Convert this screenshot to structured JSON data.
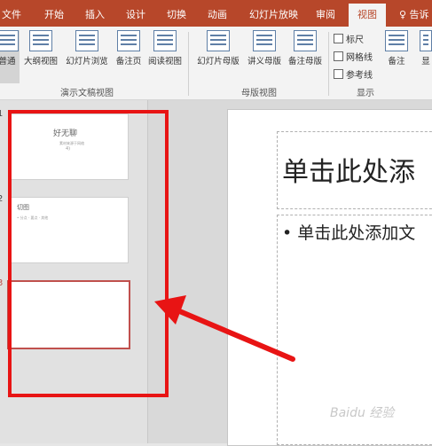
{
  "tabs": [
    {
      "label": "文件",
      "active": false
    },
    {
      "label": "开始",
      "active": false
    },
    {
      "label": "插入",
      "active": false
    },
    {
      "label": "设计",
      "active": false
    },
    {
      "label": "切换",
      "active": false
    },
    {
      "label": "动画",
      "active": false
    },
    {
      "label": "幻灯片放映",
      "active": false
    },
    {
      "label": "审阅",
      "active": false
    },
    {
      "label": "视图",
      "active": true
    }
  ],
  "tell_me": "♀ 告诉",
  "ribbon": {
    "presentation_views": {
      "label": "演示文稿视图",
      "buttons": [
        "普通",
        "大纲视图",
        "幻灯片浏览",
        "备注页",
        "阅读视图"
      ]
    },
    "master_views": {
      "label": "母版视图",
      "buttons": [
        "幻灯片母版",
        "讲义母版",
        "备注母版"
      ]
    },
    "show": {
      "label": "显示",
      "checkboxes": [
        "标尺",
        "网格线",
        "参考线"
      ],
      "notes_button": "备注",
      "cut_button": "显"
    }
  },
  "thumbnails": [
    {
      "number": "1",
      "title": "好无聊",
      "small": "素材来源于网络",
      "small2": "4)"
    },
    {
      "number": "2",
      "title": "切图",
      "small": "• 分点 · 要点 · 其他"
    },
    {
      "number": "3",
      "title": "",
      "small": "",
      "selected": true
    }
  ],
  "slide": {
    "title_placeholder": "单击此处添",
    "body_placeholder": "• 单击此处添加文"
  },
  "watermark": "Baidu 经验",
  "colors": {
    "accent": "#b7472a",
    "annotation": "#e81414"
  }
}
